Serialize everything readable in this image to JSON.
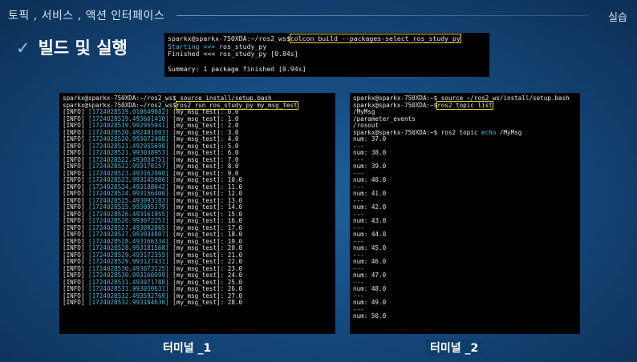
{
  "header": {
    "title": "토픽 , 서비스 , 액션 인터페이스",
    "right_label": "실습"
  },
  "section": {
    "check_icon": "✓",
    "title": "빌드 및 실행"
  },
  "build_terminal": {
    "prompt": "sparkx@sparkx-750XDA:~/ros2_ws$",
    "command": "colcon build --packages-select ros_study_py",
    "line2_a": "Starting >>> ",
    "line2_b": "ros_study_py",
    "line3": "Finished <<< ros_study_py [0.84s]",
    "line4": "",
    "summary": "Summary: 1 package finished [0.94s]"
  },
  "terminal_1": {
    "prompt": "sparkx@sparkx-750XDA:~/ros2_ws$",
    "source_cmd": "source install/setup.bash",
    "run_cmd": "ros2 run ros_study_py my_msg_test",
    "logs": [
      {
        "ts": "[1724028519.010649882]",
        "val": "0.0"
      },
      {
        "ts": "[1724028519.493601410]",
        "val": "1.0"
      },
      {
        "ts": "[1724028519.992955941]",
        "val": "2.0"
      },
      {
        "ts": "[1724028520.492481003]",
        "val": "3.0"
      },
      {
        "ts": "[1724028520.993072488]",
        "val": "4.0"
      },
      {
        "ts": "[1724028521.492955690]",
        "val": "5.0"
      },
      {
        "ts": "[1724028521.993038953]",
        "val": "6.0"
      },
      {
        "ts": "[1724028522.493024751]",
        "val": "7.0"
      },
      {
        "ts": "[1724028522.993170157]",
        "val": "8.0"
      },
      {
        "ts": "[1724028523.493162000]",
        "val": "9.0"
      },
      {
        "ts": "[1724028523.993145986]",
        "val": "10.0"
      },
      {
        "ts": "[1724028524.493188642]",
        "val": "11.0"
      },
      {
        "ts": "[1724028524.993156400]",
        "val": "12.0"
      },
      {
        "ts": "[1724028525.493093183]",
        "val": "13.0"
      },
      {
        "ts": "[1724028525.993095379]",
        "val": "14.0"
      },
      {
        "ts": "[1724028526.493161955]",
        "val": "15.0"
      },
      {
        "ts": "[1724028526.993072251]",
        "val": "16.0"
      },
      {
        "ts": "[1724028527.493092065]",
        "val": "17.0"
      },
      {
        "ts": "[1724028527.993034807]",
        "val": "18.0"
      },
      {
        "ts": "[1724028528.493166334]",
        "val": "19.0"
      },
      {
        "ts": "[1724028528.993181568]",
        "val": "20.0"
      },
      {
        "ts": "[1724028529.493172355]",
        "val": "21.0"
      },
      {
        "ts": "[1724028529.993127431]",
        "val": "22.0"
      },
      {
        "ts": "[1724028530.493073125]",
        "val": "23.0"
      },
      {
        "ts": "[1724028530.993160999]",
        "val": "24.0"
      },
      {
        "ts": "[1724028531.493071780]",
        "val": "25.0"
      },
      {
        "ts": "[1724028531.993030631]",
        "val": "26.0"
      },
      {
        "ts": "[1724028532.493592769]",
        "val": "27.0"
      },
      {
        "ts": "[1724028532.993104636]",
        "val": "28.0"
      }
    ],
    "log_level": "[INFO]",
    "log_node": " [my_msg_test]: "
  },
  "terminal_2": {
    "prompt": "sparkx@sparkx-750XDA:~$",
    "source_cmd": "source ~/ros2_ws/install/setup.bash",
    "list_cmd": "ros2 topic list",
    "topics": [
      "/MyMsg",
      "/parameter_events",
      "/rosout"
    ],
    "echo_cmd_a": "ros2 topic ",
    "echo_cmd_b": "echo",
    "echo_cmd_c": " /MyMsg",
    "separator": "---",
    "nums": [
      "num: 37.0",
      "num: 38.0",
      "num: 39.0",
      "num: 40.0",
      "num: 41.0",
      "num: 42.0",
      "num: 43.0",
      "num: 44.0",
      "num: 45.0",
      "num: 46.0",
      "num: 47.0",
      "num: 48.0",
      "num: 49.0",
      "num: 50.0"
    ]
  },
  "captions": {
    "terminal_1": "터미널 _1",
    "terminal_2": "터미널 _2"
  }
}
